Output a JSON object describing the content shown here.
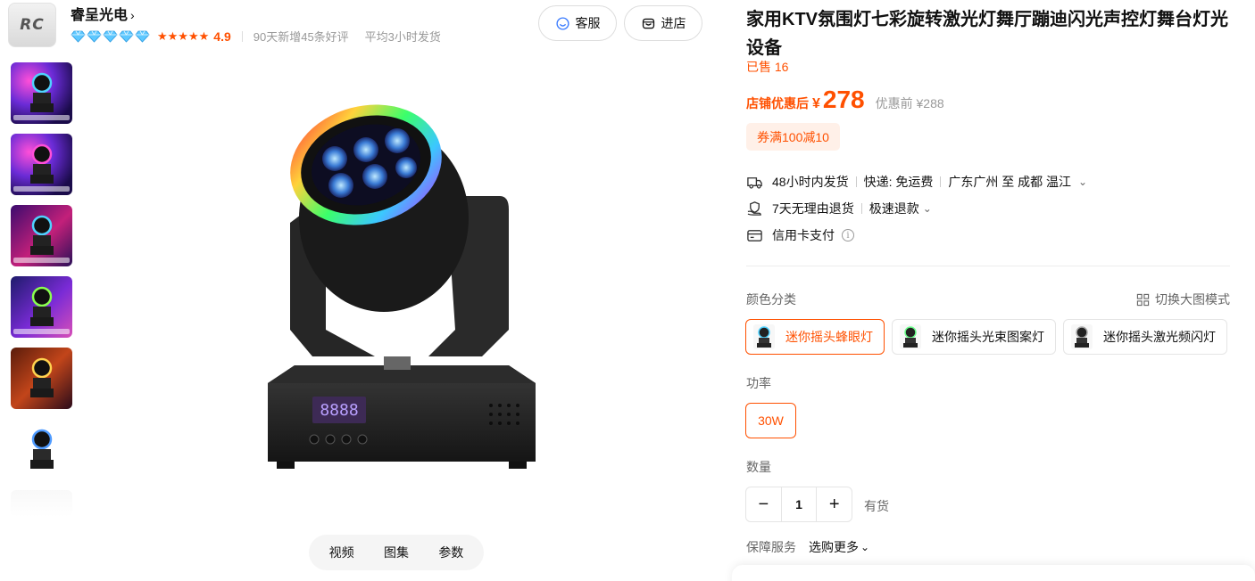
{
  "shop": {
    "logo_text": "RC",
    "name": "睿呈光电",
    "name_chevron": "›",
    "diamonds": 5,
    "stars": "★★★★★",
    "rating": "4.9",
    "new_reviews": "90天新增45条好评",
    "avg_ship": "平均3小时发货",
    "service_label": "客服",
    "enter_label": "进店"
  },
  "gallery": {
    "thumbnail_count": 7,
    "tabs": [
      "视频",
      "图集",
      "参数"
    ]
  },
  "product": {
    "title": "家用KTV氛围灯七彩旋转激光灯舞厅蹦迪闪光声控灯舞台灯光设备",
    "sold": "已售 16",
    "price_label": "店铺优惠后",
    "currency": "¥",
    "price": "278",
    "original_price": "优惠前 ¥288",
    "coupon": "券满100减10",
    "accent_color": "#ff5000"
  },
  "shipping": {
    "ship_time": "48小时内发货",
    "express": "快递: 免运费",
    "route": "广东广州 至 成都 温江",
    "route_caret": "⌄",
    "returns": "7天无理由退货",
    "refund": "极速退款",
    "refund_caret": "⌄",
    "payment": "信用卡支付",
    "payment_info": "i"
  },
  "options": {
    "color_label": "颜色分类",
    "switch_view": "切换大图模式",
    "colors": [
      "迷你摇头蜂眼灯",
      "迷你摇头光束图案灯",
      "迷你摇头激光频闪灯"
    ],
    "selected_color": 0,
    "power_label": "功率",
    "power_value": "30W",
    "quantity_label": "数量",
    "minus": "−",
    "quantity": "1",
    "plus": "+",
    "stock": "有货",
    "guarantee_label": "保障服务",
    "guarantee_more": "选购更多",
    "guarantee_caret": "⌄"
  }
}
